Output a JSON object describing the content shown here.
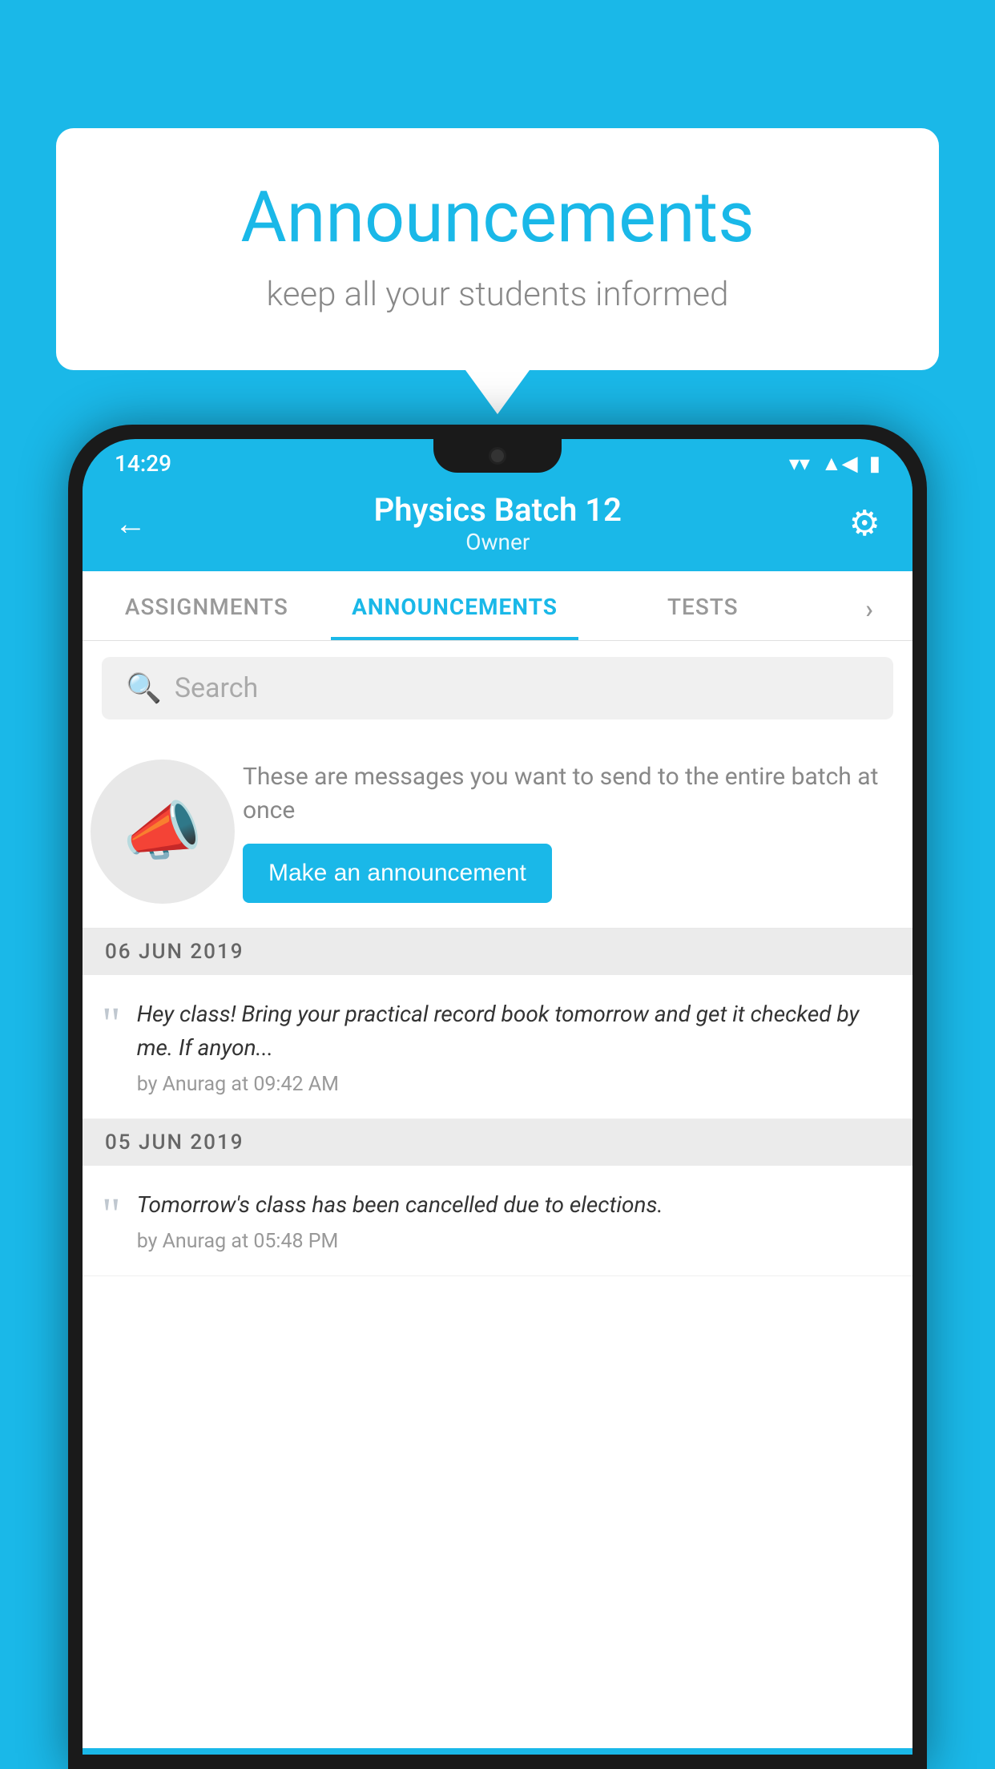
{
  "background_color": "#1ab8e8",
  "speech_bubble": {
    "title": "Announcements",
    "subtitle": "keep all your students informed"
  },
  "status_bar": {
    "time": "14:29",
    "wifi": "▼",
    "signal": "▲",
    "battery": "▮"
  },
  "header": {
    "back_label": "←",
    "title": "Physics Batch 12",
    "subtitle": "Owner",
    "settings_label": "⚙"
  },
  "tabs": [
    {
      "label": "ASSIGNMENTS",
      "active": false
    },
    {
      "label": "ANNOUNCEMENTS",
      "active": true
    },
    {
      "label": "TESTS",
      "active": false
    }
  ],
  "search": {
    "placeholder": "Search"
  },
  "promo": {
    "text": "These are messages you want to send to the entire batch at once",
    "button_label": "Make an announcement"
  },
  "announcements": [
    {
      "date": "06  JUN  2019",
      "text": "Hey class! Bring your practical record book tomorrow and get it checked by me. If anyon...",
      "meta": "by Anurag at 09:42 AM"
    },
    {
      "date": "05  JUN  2019",
      "text": "Tomorrow's class has been cancelled due to elections.",
      "meta": "by Anurag at 05:48 PM"
    }
  ]
}
